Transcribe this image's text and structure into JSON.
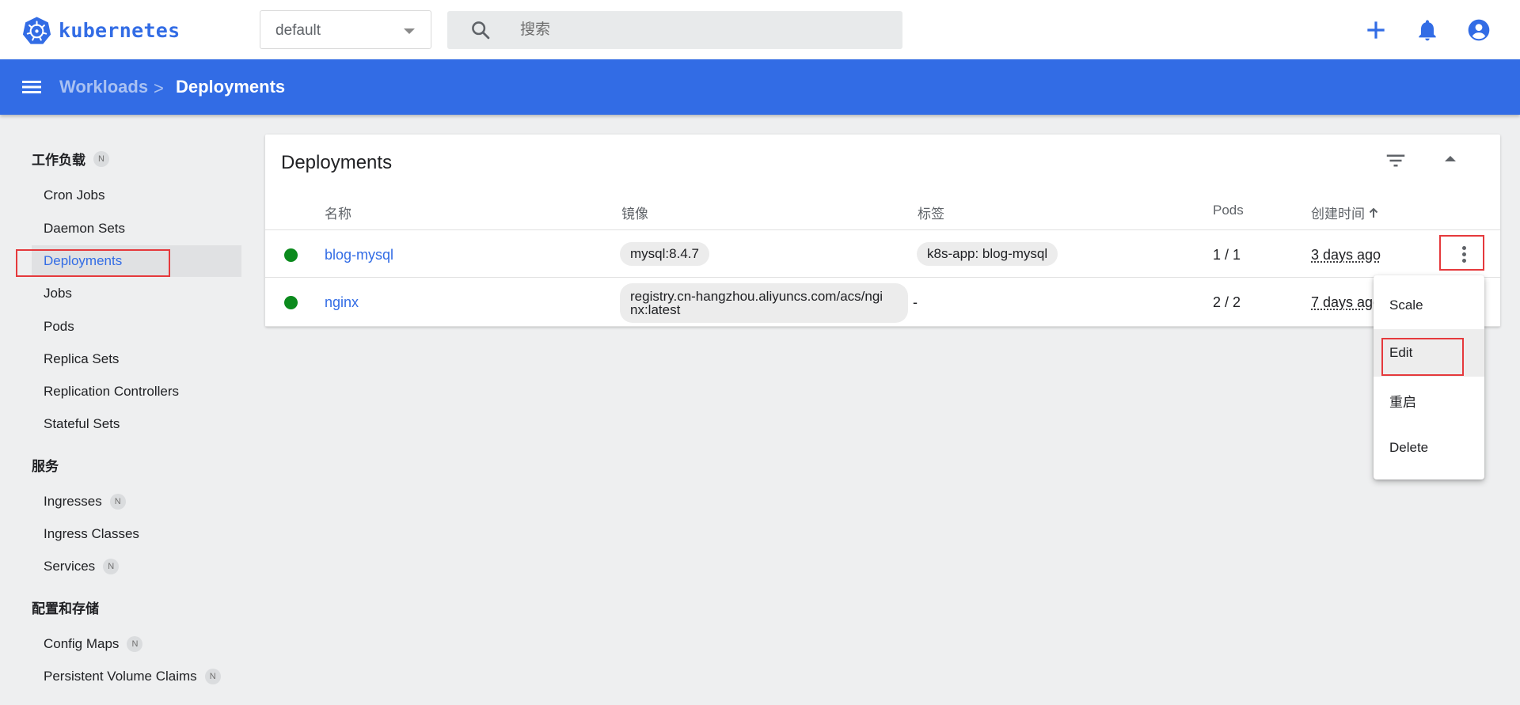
{
  "header": {
    "logo_text": "kubernetes",
    "namespace": "default",
    "search_placeholder": "搜索",
    "icons": [
      "plus-icon",
      "bell-icon",
      "account-icon"
    ],
    "accent_color": "#326ce5"
  },
  "breadcrumb": {
    "parent": "Workloads",
    "separator": ">",
    "current": "Deployments"
  },
  "sidebar": {
    "sections": [
      {
        "title": "工作负载",
        "badge": "N",
        "items": [
          {
            "label": "Cron Jobs"
          },
          {
            "label": "Daemon Sets"
          },
          {
            "label": "Deployments",
            "active": true
          },
          {
            "label": "Jobs"
          },
          {
            "label": "Pods"
          },
          {
            "label": "Replica Sets"
          },
          {
            "label": "Replication Controllers"
          },
          {
            "label": "Stateful Sets"
          }
        ]
      },
      {
        "title": "服务",
        "items": [
          {
            "label": "Ingresses",
            "badge": "N"
          },
          {
            "label": "Ingress Classes"
          },
          {
            "label": "Services",
            "badge": "N"
          }
        ]
      },
      {
        "title": "配置和存储",
        "items": [
          {
            "label": "Config Maps",
            "badge": "N"
          },
          {
            "label": "Persistent Volume Claims",
            "badge": "N"
          }
        ]
      }
    ]
  },
  "card": {
    "title": "Deployments",
    "columns": [
      "名称",
      "镜像",
      "标签",
      "Pods",
      "创建时间"
    ],
    "sort_column": "创建时间",
    "rows": [
      {
        "status": "running",
        "name": "blog-mysql",
        "image": "mysql:8.4.7",
        "label": "k8s-app: blog-mysql",
        "pods": "1 / 1",
        "created": "3 days ago"
      },
      {
        "status": "running",
        "name": "nginx",
        "image_line1": "registry.cn-hangzhou.aliyuncs.com/acs/ngi",
        "image_line2": "nx:latest",
        "label": "-",
        "pods": "2 / 2",
        "created": "7 days ago"
      }
    ]
  },
  "action_menu": {
    "items": [
      "Scale",
      "Edit",
      "重启",
      "Delete"
    ],
    "hovered": "Edit"
  },
  "colors": {
    "status_running": "#0b8a1d",
    "highlight_box": "#e5393c"
  }
}
